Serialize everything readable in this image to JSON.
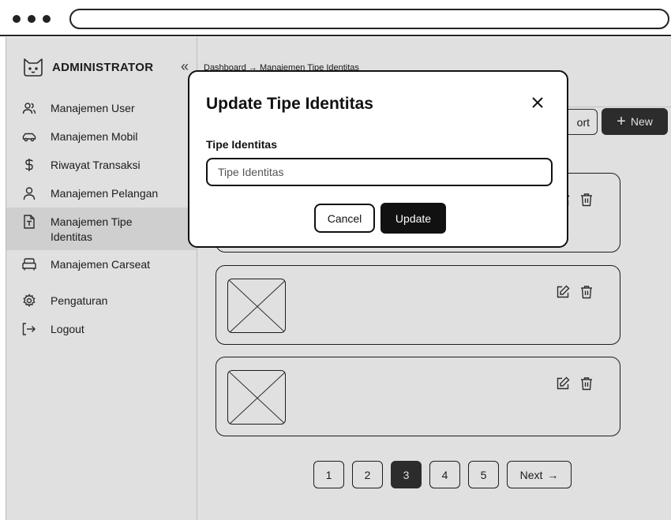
{
  "browser": {
    "address": ""
  },
  "sidebar": {
    "brand": "ADMINISTRATOR",
    "collapse_icon": "«",
    "items": [
      {
        "label": "Manajemen User",
        "icon": "users-icon"
      },
      {
        "label": "Manajemen Mobil",
        "icon": "car-icon"
      },
      {
        "label": "Riwayat Transaksi",
        "icon": "dollar-icon"
      },
      {
        "label": "Manajemen Pelangan",
        "icon": "user-icon"
      },
      {
        "label": "Manajemen Tipe\nIdentitas",
        "icon": "document-icon",
        "active": true
      },
      {
        "label": "Manajemen Carseat",
        "icon": "seat-icon"
      },
      {
        "label": "Pengaturan",
        "icon": "gear-icon"
      },
      {
        "label": "Logout",
        "icon": "logout-icon"
      }
    ]
  },
  "main": {
    "breadcrumb": [
      "Dashboard",
      "Manajemen Tipe Identitas"
    ],
    "breadcrumb_separator": "→",
    "export_label": "ort",
    "new_label": "New",
    "cards": [
      {
        "edit_icon": "edit-icon",
        "delete_icon": "trash-icon"
      },
      {
        "edit_icon": "edit-icon",
        "delete_icon": "trash-icon"
      },
      {
        "edit_icon": "edit-icon",
        "delete_icon": "trash-icon"
      }
    ],
    "pagination": {
      "pages": [
        "1",
        "2",
        "3",
        "4",
        "5"
      ],
      "current": "3",
      "next_label": "Next",
      "next_icon": "→"
    }
  },
  "modal": {
    "title": "Update Tipe Identitas",
    "field_label": "Tipe Identitas",
    "field_placeholder": "Tipe Identitas",
    "field_value": "",
    "cancel_label": "Cancel",
    "update_label": "Update"
  },
  "colors": {
    "accent_dark": "#333333",
    "border": "#222222",
    "active_bg": "#ececec",
    "overlay": "rgba(0,0,0,0.12)"
  }
}
